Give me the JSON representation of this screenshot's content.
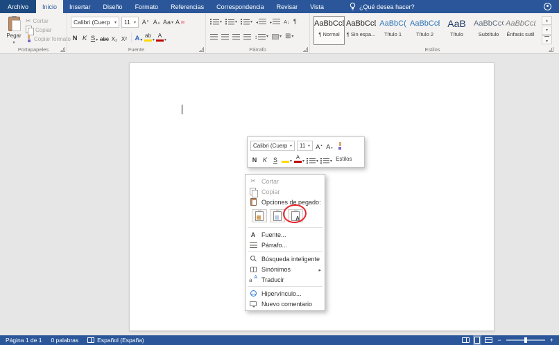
{
  "colors": {
    "accent": "#2b579a",
    "heading_blue": "#2e74b5",
    "annotation_red": "#e8232b",
    "highlight_yellow": "#ffda00",
    "font_color_red": "#c00000"
  },
  "tab_bar": {
    "tabs": [
      "Archivo",
      "Inicio",
      "Insertar",
      "Diseño",
      "Formato",
      "Referencias",
      "Correspondencia",
      "Revisar",
      "Vista"
    ],
    "active_tab": "Inicio",
    "tell_me_label": "¿Qué desea hacer?"
  },
  "ribbon": {
    "clipboard": {
      "group_label": "Portapapeles",
      "paste_label": "Pegar",
      "cut_label": "Cortar",
      "copy_label": "Copiar",
      "format_painter_label": "Copiar formato"
    },
    "font": {
      "group_label": "Fuente",
      "font_name": "Calibri (Cuerp",
      "font_size": "11",
      "grow_label": "A",
      "shrink_label": "A",
      "case_label": "Aa",
      "clear_label": "A",
      "bold_label": "N",
      "italic_label": "K",
      "underline_label": "S",
      "strike_label": "abc",
      "subscript_label": "X₂",
      "superscript_label": "X²",
      "effects_label": "A",
      "highlight_label": "ab",
      "font_color_label": "A"
    },
    "paragraph": {
      "group_label": "Párrafo"
    },
    "styles": {
      "group_label": "Estilos",
      "items": [
        {
          "preview": "AaBbCcDc",
          "name": "¶ Normal"
        },
        {
          "preview": "AaBbCcDc",
          "name": "¶ Sin espa..."
        },
        {
          "preview": "AaBbC(",
          "name": "Título 1"
        },
        {
          "preview": "AaBbCcE",
          "name": "Título 2"
        },
        {
          "preview": "AaB",
          "name": "Título"
        },
        {
          "preview": "AaBbCcC",
          "name": "Subtítulo"
        },
        {
          "preview": "AaBbCcDc",
          "name": "Énfasis sutil"
        }
      ]
    }
  },
  "mini_toolbar": {
    "font_name": "Calibri (Cuerp",
    "font_size": "11",
    "grow_label": "A",
    "shrink_label": "A",
    "bold_label": "N",
    "italic_label": "K",
    "underline_label": "S",
    "styles_label": "Estilos"
  },
  "context_menu": {
    "cut": "Cortar",
    "copy": "Copiar",
    "paste_options_label": "Opciones de pegado:",
    "font": "Fuente...",
    "paragraph": "Párrafo...",
    "smart_lookup": "Búsqueda inteligente",
    "synonyms": "Sinónimos",
    "translate": "Traducir",
    "hyperlink": "Hipervínculo...",
    "new_comment": "Nuevo comentario"
  },
  "status_bar": {
    "page_info": "Página 1 de 1",
    "word_count": "0 palabras",
    "language": "Español (España)"
  }
}
